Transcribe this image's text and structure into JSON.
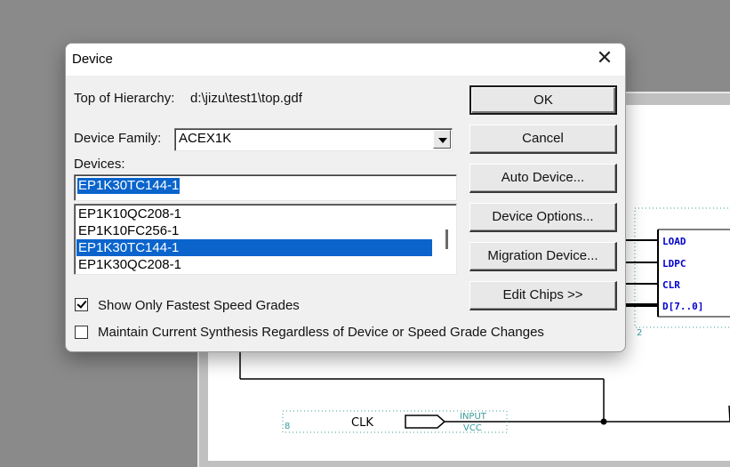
{
  "dialog": {
    "title": "Device",
    "top_of_hierarchy_label": "Top of Hierarchy:",
    "top_of_hierarchy_value": "d:\\jizu\\test1\\top.gdf",
    "device_family_label": "Device Family:",
    "device_family_value": "ACEX1K",
    "devices_label": "Devices:",
    "devices_input_value": "EP1K30TC144-1",
    "devices_list": [
      {
        "label": "EP1K10QC208-1",
        "selected": false
      },
      {
        "label": "EP1K10FC256-1",
        "selected": false
      },
      {
        "label": "EP1K30TC144-1",
        "selected": true
      },
      {
        "label": "EP1K30QC208-1",
        "selected": false
      }
    ],
    "buttons": {
      "ok": "OK",
      "cancel": "Cancel",
      "auto_device": "Auto Device...",
      "device_options": "Device Options...",
      "migration_device": "Migration Device...",
      "edit_chips": "Edit Chips >>"
    },
    "checkboxes": {
      "fastest_speed": {
        "label": "Show Only Fastest Speed Grades",
        "checked": true
      },
      "maintain_synthesis": {
        "label": "Maintain Current Synthesis Regardless of Device or Speed Grade Changes",
        "checked": false
      }
    }
  },
  "schematic": {
    "pins": [
      "LOAD",
      "LDPC",
      "CLR",
      "D[7..0]"
    ],
    "clk_label": "CLK",
    "input_label": "INPUT",
    "vcc_label": "VCC",
    "pin_number_8": "8",
    "pin_number_2": "2",
    "pin_color": "#0000cc"
  }
}
